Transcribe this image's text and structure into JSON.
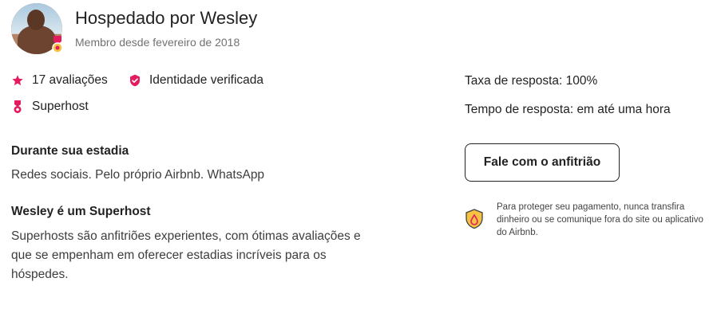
{
  "host": {
    "title": "Hospedado por Wesley",
    "member_since": "Membro desde fevereiro de 2018"
  },
  "stats": {
    "reviews": "17 avaliações",
    "identity": "Identidade verificada",
    "superhost": "Superhost"
  },
  "during_stay": {
    "heading": "Durante sua estadia",
    "text": "Redes sociais. Pelo próprio Airbnb. WhatsApp"
  },
  "superhost_section": {
    "heading": "Wesley é um Superhost",
    "text": "Superhosts são anfitriões experientes, com ótimas avaliações e que se empenham em oferecer estadias incríveis para os hóspedes."
  },
  "response": {
    "rate": "Taxa de resposta: 100%",
    "time": "Tempo de resposta: em até uma hora"
  },
  "contact_button": "Fale com o anfitrião",
  "payment_notice": "Para proteger seu pagamento, nunca transfira dinheiro ou se comunique fora do site ou aplicativo do Airbnb.",
  "colors": {
    "accent": "#E31C5F",
    "text": "#222222",
    "muted": "#717171"
  },
  "icons": [
    "star-icon",
    "shield-check-icon",
    "superhost-medal-icon",
    "payment-protection-icon"
  ]
}
